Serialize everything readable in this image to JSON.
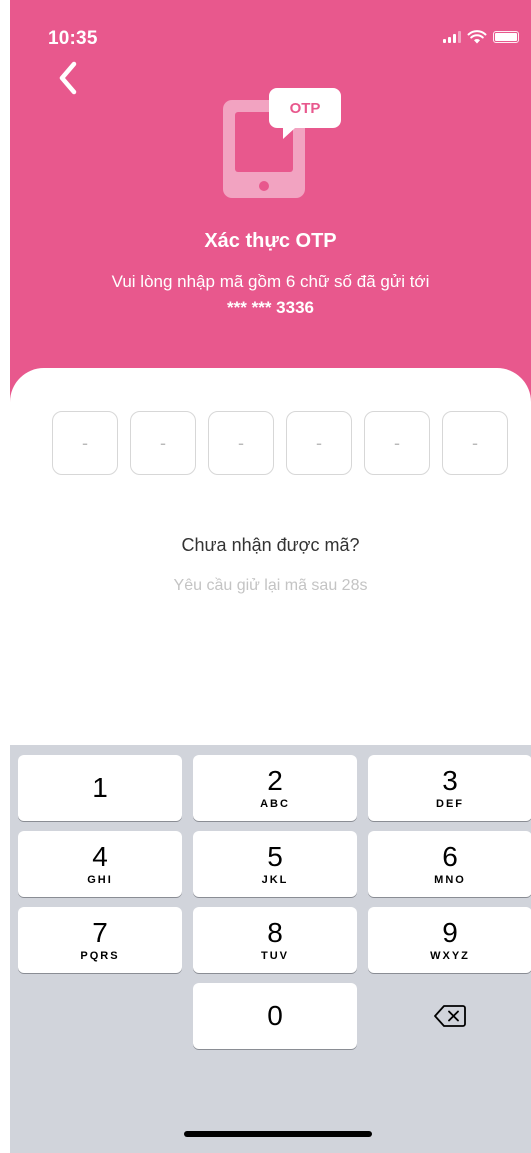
{
  "status_bar": {
    "time": "10:35"
  },
  "header": {
    "illustration_badge": "OTP",
    "title": "Xác thực OTP",
    "subtitle": "Vui lòng nhập mã gồm 6 chữ số đã gửi tới",
    "phone_masked": "*** *** 3336"
  },
  "otp": {
    "boxes": [
      "-",
      "-",
      "-",
      "-",
      "-",
      "-"
    ]
  },
  "resend": {
    "question": "Chưa nhận được mã?",
    "countdown_text": "Yêu cầu giử lại mã sau 28s"
  },
  "keyboard": {
    "keys": [
      {
        "digit": "1",
        "letters": ""
      },
      {
        "digit": "2",
        "letters": "ABC"
      },
      {
        "digit": "3",
        "letters": "DEF"
      },
      {
        "digit": "4",
        "letters": "GHI"
      },
      {
        "digit": "5",
        "letters": "JKL"
      },
      {
        "digit": "6",
        "letters": "MNO"
      },
      {
        "digit": "7",
        "letters": "PQRS"
      },
      {
        "digit": "8",
        "letters": "TUV"
      },
      {
        "digit": "9",
        "letters": "WXYZ"
      },
      {
        "digit": "0",
        "letters": ""
      }
    ]
  },
  "colors": {
    "brand_pink": "#e8588d",
    "keyboard_bg": "#d1d4db"
  },
  "icons": [
    "back-chevron-icon",
    "signal-icon",
    "wifi-icon",
    "battery-icon",
    "phone-otp-icon",
    "delete-icon"
  ]
}
